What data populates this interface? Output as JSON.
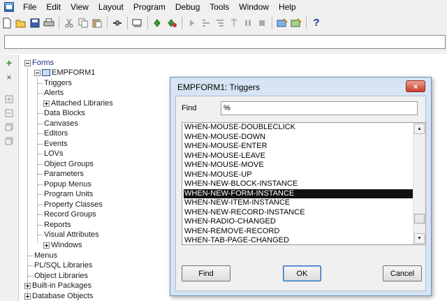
{
  "menu": [
    "File",
    "Edit",
    "View",
    "Layout",
    "Program",
    "Debug",
    "Tools",
    "Window",
    "Help"
  ],
  "toolbar": {
    "icons": [
      "new-icon",
      "open-icon",
      "save-icon",
      "print-icon",
      "cut-icon",
      "copy-icon",
      "paste-icon",
      "connect-icon",
      "compile-icon",
      "run-form-icon",
      "debug-run-icon",
      "step-into-icon",
      "step-over-icon",
      "step-out-icon",
      "pause-icon",
      "stop-icon",
      "wizard-icon",
      "layout-wizard-icon"
    ],
    "help_label": "?"
  },
  "rail": {
    "add": "+",
    "remove": "×"
  },
  "tree": {
    "forms": "Forms",
    "form_name": "EMPFORM1",
    "children": [
      "Triggers",
      "Alerts",
      "Attached Libraries",
      "Data Blocks",
      "Canvases",
      "Editors",
      "Events",
      "LOVs",
      "Object Groups",
      "Parameters",
      "Popup Menus",
      "Program Units",
      "Property Classes",
      "Record Groups",
      "Reports",
      "Visual Attributes",
      "Windows"
    ],
    "top_level": [
      "Menus",
      "PL/SQL Libraries",
      "Object Libraries",
      "Built-in Packages",
      "Database Objects"
    ]
  },
  "dialog": {
    "title": "EMPFORM1: Triggers",
    "close": "×",
    "find_label": "Find",
    "find_value": "%",
    "items": [
      "WHEN-MOUSE-DOUBLECLICK",
      "WHEN-MOUSE-DOWN",
      "WHEN-MOUSE-ENTER",
      "WHEN-MOUSE-LEAVE",
      "WHEN-MOUSE-MOVE",
      "WHEN-MOUSE-UP",
      "WHEN-NEW-BLOCK-INSTANCE",
      "WHEN-NEW-FORM-INSTANCE",
      "WHEN-NEW-ITEM-INSTANCE",
      "WHEN-NEW-RECORD-INSTANCE",
      "WHEN-RADIO-CHANGED",
      "WHEN-REMOVE-RECORD",
      "WHEN-TAB-PAGE-CHANGED"
    ],
    "selected_index": 7,
    "buttons": {
      "find": "Find",
      "ok": "OK",
      "cancel": "Cancel"
    }
  }
}
